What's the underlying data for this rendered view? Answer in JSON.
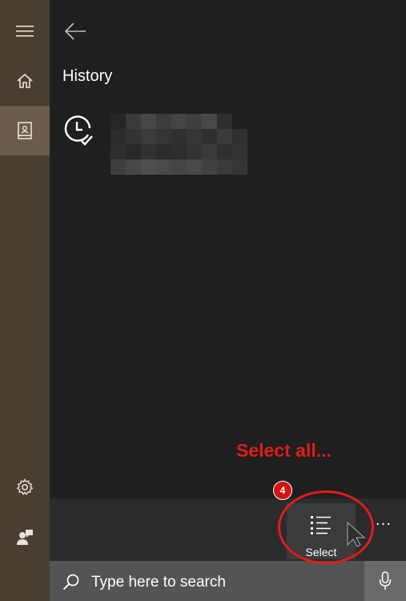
{
  "sidebar": {
    "items": [
      {
        "icon": "hamburger-menu-icon"
      },
      {
        "icon": "home-icon"
      },
      {
        "icon": "notebook-icon",
        "active": true
      },
      {
        "icon": "gear-icon"
      },
      {
        "icon": "feedback-icon"
      }
    ]
  },
  "main": {
    "title": "History",
    "back_icon": "back-arrow-icon",
    "history_icon": "clock-check-icon"
  },
  "annotation": {
    "text": "Select all...",
    "step": "4",
    "color": "#e21b1b"
  },
  "command_bar": {
    "select_label": "Select",
    "select_icon": "select-list-icon",
    "more_label": "···"
  },
  "search": {
    "placeholder": "Type here to search",
    "icon": "search-icon",
    "mic_icon": "microphone-icon"
  },
  "colors": {
    "rail": "#4a3e31",
    "rail_active": "#6b5d4c",
    "background": "#1f1f1f",
    "command_bar": "#2b2b2b",
    "search_bar": "#545454"
  }
}
